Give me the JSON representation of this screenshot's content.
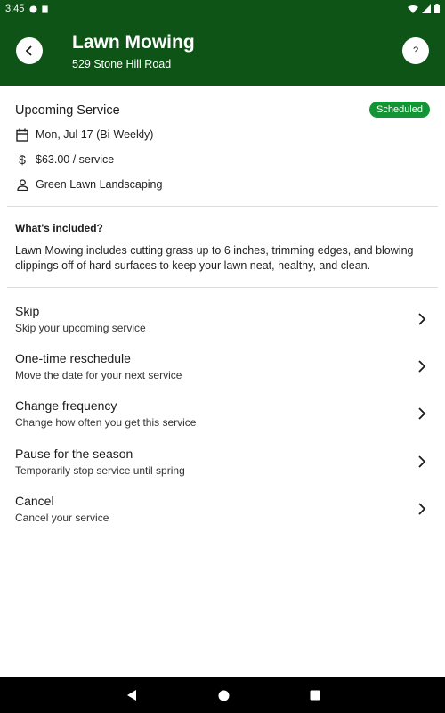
{
  "status_bar": {
    "time": "3:45"
  },
  "header": {
    "title": "Lawn Mowing",
    "subtitle": "529 Stone Hill Road",
    "help_label": "?"
  },
  "upcoming": {
    "title": "Upcoming Service",
    "badge": "Scheduled",
    "date": "Mon, Jul 17 (Bi-Weekly)",
    "price": "$63.00 / service",
    "provider": "Green Lawn Landscaping"
  },
  "included": {
    "title": "What's included?",
    "text": "Lawn Mowing includes cutting grass up to 6 inches, trimming edges, and blowing clippings off of hard surfaces to keep your lawn neat, healthy, and clean."
  },
  "actions": [
    {
      "title": "Skip",
      "subtitle": "Skip your upcoming service"
    },
    {
      "title": "One-time reschedule",
      "subtitle": "Move the date for your next service"
    },
    {
      "title": "Change frequency",
      "subtitle": "Change how often you get this service"
    },
    {
      "title": "Pause for the season",
      "subtitle": "Temporarily stop service until spring"
    },
    {
      "title": "Cancel",
      "subtitle": "Cancel your service"
    }
  ],
  "colors": {
    "header_green": "#0d5416",
    "badge_green": "#139435"
  }
}
